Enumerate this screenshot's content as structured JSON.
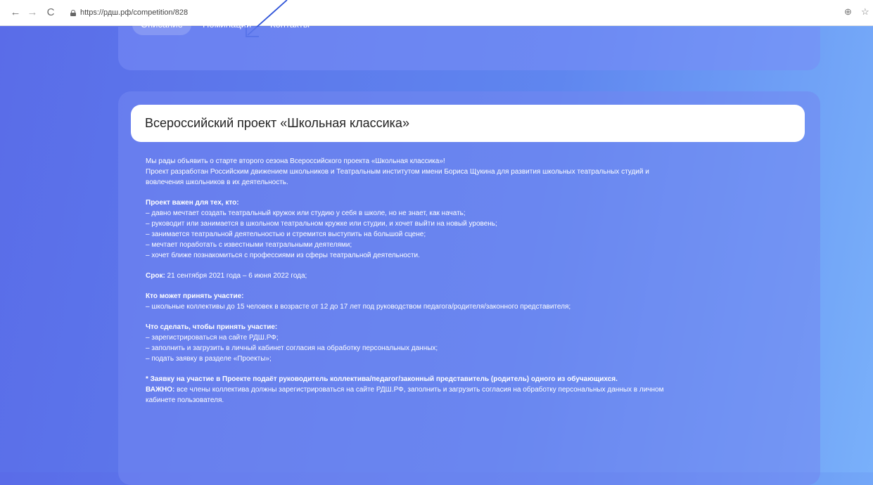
{
  "browser": {
    "back": "←",
    "forward": "→",
    "reload": "C",
    "url": "https://рдш.рф/competition/828",
    "zoom_icon": "⊕",
    "star_icon": "☆"
  },
  "tabs": [
    {
      "label": "Описание"
    },
    {
      "label": "Номинации"
    },
    {
      "label": "Контакты"
    }
  ],
  "title": "Всероссийский проект «Школьная классика»",
  "intro": [
    "Мы рады объявить о старте второго сезона Всероссийского проекта «Школьная классика»!",
    "Проект разработан Российским движением школьников и Театральным институтом имени Бориса Щукина для развития школьных театральных студий и",
    "вовлечения школьников в их деятельность."
  ],
  "important_for": {
    "heading": "Проект важен для тех, кто:",
    "items": [
      "– давно мечтает создать театральный кружок или студию у себя в школе, но не знает, как начать;",
      "– руководит или занимается в школьном театральном кружке или студии, и хочет выйти на новый уровень;",
      "– занимается театральной деятельностью и стремится выступить на большой сцене;",
      "– мечтает поработать с известными театральными деятелями;",
      "– хочет ближе познакомиться с профессиями из сферы театральной деятельности."
    ]
  },
  "term": {
    "label": "Срок:",
    "value": " 21 сентября 2021 года – 6 июня 2022 года;"
  },
  "who": {
    "heading": "Кто может принять участие:",
    "items": [
      "– школьные коллективы до 15 человек в возрасте от 12 до 17 лет под руководством педагога/родителя/законного представителя;"
    ]
  },
  "how": {
    "heading": "Что сделать, чтобы принять участие:",
    "items": [
      "– зарегистрироваться на сайте РДШ.РФ;",
      "– заполнить и загрузить в личный кабинет согласия на обработку персональных данных;",
      "– подать заявку в разделе «Проекты»;"
    ]
  },
  "note": "* Заявку на участие в Проекте подаёт руководитель коллектива/педагог/законный представитель (родитель) одного из обучающихся.",
  "important": {
    "label": "ВАЖНО:",
    "text": " все члены коллектива должны зарегистрироваться на сайте РДШ.РФ, заполнить и загрузить согласия на обработку персональных данных в личном",
    "text2": "кабинете пользователя."
  }
}
